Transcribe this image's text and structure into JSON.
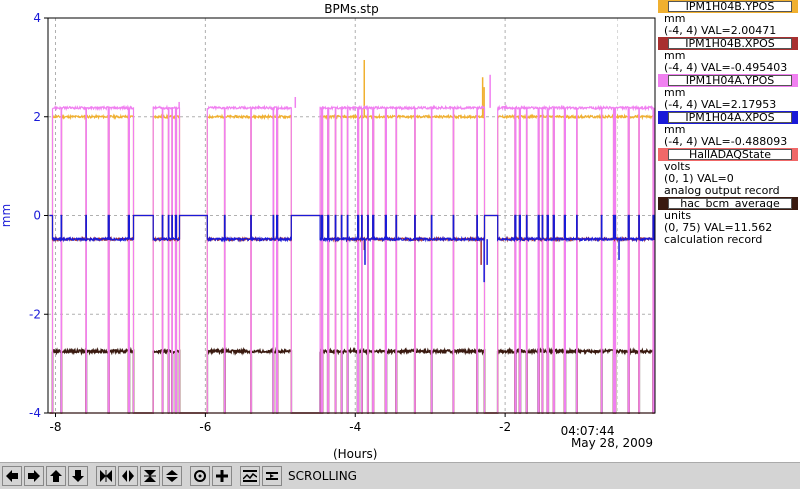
{
  "chart_data": {
    "type": "line",
    "title": "BPMs.stp",
    "xlabel": "(Hours)",
    "ylabel": "mm",
    "xlim": [
      -8.1,
      0
    ],
    "ylim": [
      -4,
      4
    ],
    "x_ticks": [
      "-8",
      "-6",
      "-4",
      "-2"
    ],
    "y_ticks": [
      "4",
      "2",
      "0",
      "-2",
      "-4"
    ],
    "time_label": "04:07:44",
    "date_label": "May 28, 2009",
    "grid": true,
    "series": [
      {
        "name": "IPM1H04B.YPOS",
        "color": "#f0b030",
        "base": 2.0,
        "beamoff": -4.0,
        "spikes": [
          [
            -3.88,
            3.15
          ],
          [
            -2.3,
            2.8
          ],
          [
            -2.28,
            2.6
          ]
        ]
      },
      {
        "name": "IPM1H04B.XPOS",
        "color": "#a83030",
        "base": -0.48,
        "beamoff": 0.0,
        "spikes": [
          [
            -3.88,
            -0.7
          ],
          [
            -2.32,
            -1.0
          ]
        ]
      },
      {
        "name": "IPM1H04A.YPOS",
        "color": "#f080f0",
        "base": 2.18,
        "beamoff": -4.0,
        "spikes": [
          [
            -6.35,
            2.3
          ],
          [
            -4.8,
            2.4
          ],
          [
            -2.2,
            2.85
          ]
        ]
      },
      {
        "name": "IPM1H04A.XPOS",
        "color": "#1a1ad8",
        "base": -0.48,
        "beamoff": 0.0,
        "spikes": [
          [
            -3.87,
            -1.0
          ],
          [
            -2.28,
            -1.35
          ],
          [
            -2.24,
            -1.0
          ],
          [
            -0.48,
            -0.9
          ]
        ]
      },
      {
        "name": "HallADAQState",
        "color": "#f06868",
        "base": -4.0,
        "beamoff": -4.0,
        "spikes": []
      },
      {
        "name": "hac_bcm_average",
        "color": "#3a1a10",
        "base": -2.75,
        "beamoff": -4.0,
        "spikes": []
      }
    ],
    "beam_off_intervals": [
      [
        -8.08,
        -8.04
      ],
      [
        -7.93,
        -7.92
      ],
      [
        -7.6,
        -7.59
      ],
      [
        -7.3,
        -7.29
      ],
      [
        -7.03,
        -7.02
      ],
      [
        -6.96,
        -6.7
      ],
      [
        -6.58,
        -6.57
      ],
      [
        -6.5,
        -6.49
      ],
      [
        -6.45,
        -6.44
      ],
      [
        -6.4,
        -6.39
      ],
      [
        -6.35,
        -5.98
      ],
      [
        -5.75,
        -5.74
      ],
      [
        -5.4,
        -5.39
      ],
      [
        -5.1,
        -5.09
      ],
      [
        -5.05,
        -5.04
      ],
      [
        -4.86,
        -4.47
      ],
      [
        -4.45,
        -4.44
      ],
      [
        -4.37,
        -4.36
      ],
      [
        -4.27,
        -4.26
      ],
      [
        -4.19,
        -4.18
      ],
      [
        -4.11,
        -4.1
      ],
      [
        -3.97,
        -3.96
      ],
      [
        -3.92,
        -3.91
      ],
      [
        -3.84,
        -3.83
      ],
      [
        -3.77,
        -3.76
      ],
      [
        -3.6,
        -3.59
      ],
      [
        -3.46,
        -3.45
      ],
      [
        -3.21,
        -3.2
      ],
      [
        -2.99,
        -2.98
      ],
      [
        -2.7,
        -2.69
      ],
      [
        -2.38,
        -2.37
      ],
      [
        -2.28,
        -2.1
      ],
      [
        -1.87,
        -1.86
      ],
      [
        -1.81,
        -1.8
      ],
      [
        -1.72,
        -1.71
      ],
      [
        -1.56,
        -1.55
      ],
      [
        -1.51,
        -1.5
      ],
      [
        -1.44,
        -1.43
      ],
      [
        -1.36,
        -1.35
      ],
      [
        -1.21,
        -1.2
      ],
      [
        -1.05,
        -1.04
      ],
      [
        -0.72,
        -0.71
      ],
      [
        -0.56,
        -0.55
      ],
      [
        -0.54,
        -0.53
      ],
      [
        -0.36,
        -0.35
      ],
      [
        -0.22,
        -0.21
      ],
      [
        -0.03,
        -0.02
      ]
    ]
  },
  "legend": [
    {
      "name": "IPM1H04B.YPOS",
      "color": "#f0b030",
      "lines": [
        "mm",
        "(-4, 4) VAL=2.00471"
      ]
    },
    {
      "name": "IPM1H04B.XPOS",
      "color": "#a83030",
      "lines": [
        "mm",
        "(-4, 4) VAL=-0.495403"
      ]
    },
    {
      "name": "IPM1H04A.YPOS",
      "color": "#f080f0",
      "lines": [
        "mm",
        "(-4, 4) VAL=2.17953"
      ]
    },
    {
      "name": "IPM1H04A.XPOS",
      "color": "#1a1ad8",
      "lines": [
        "mm",
        "(-4, 4) VAL=-0.488093"
      ]
    },
    {
      "name": "HallADAQState",
      "color": "#f06868",
      "lines": [
        "volts",
        "(0, 1) VAL=0",
        "analog output record"
      ]
    },
    {
      "name": "hac_bcm_average",
      "color": "#3a1a10",
      "lines": [
        "units",
        "(0, 75) VAL=11.562",
        "calculation record"
      ]
    }
  ],
  "toolbar": {
    "buttons": [
      "arrow-left-icon",
      "arrow-right-icon",
      "arrow-up-icon",
      "arrow-down-icon",
      "zoom-in-horizontal-icon",
      "zoom-out-horizontal-icon",
      "zoom-in-vertical-icon",
      "zoom-out-vertical-icon",
      "auto-scale-icon",
      "zoom-icon",
      "config-icon"
    ],
    "mode_label": "SCROLLING"
  }
}
